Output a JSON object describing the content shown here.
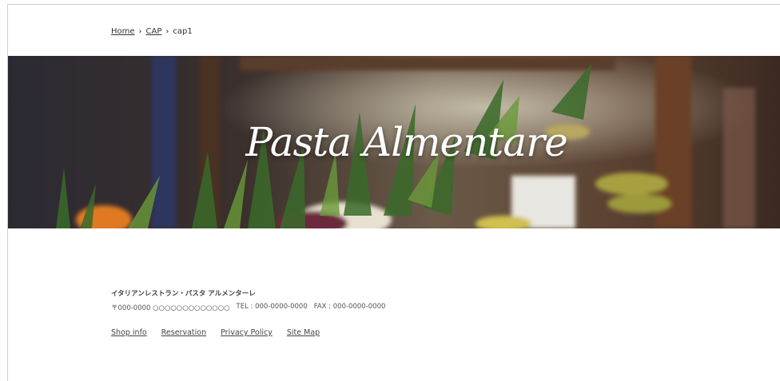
{
  "breadcrumb": {
    "home": "Home",
    "cap": "CAP",
    "current": "cap1",
    "separator": "›"
  },
  "hero": {
    "title": "Pasta Almentare"
  },
  "footer": {
    "shop_name": "イタリアンレストラン・パスタ アルメンターレ",
    "postal": "〒000-0000 ○○○○○○○○○○○○○",
    "tel": "TEL : 000-0000-0000",
    "fax": "FAX : 000-0000-0000",
    "links": [
      "Shop info",
      "Reservation",
      "Privacy Policy",
      "Site Map"
    ]
  }
}
